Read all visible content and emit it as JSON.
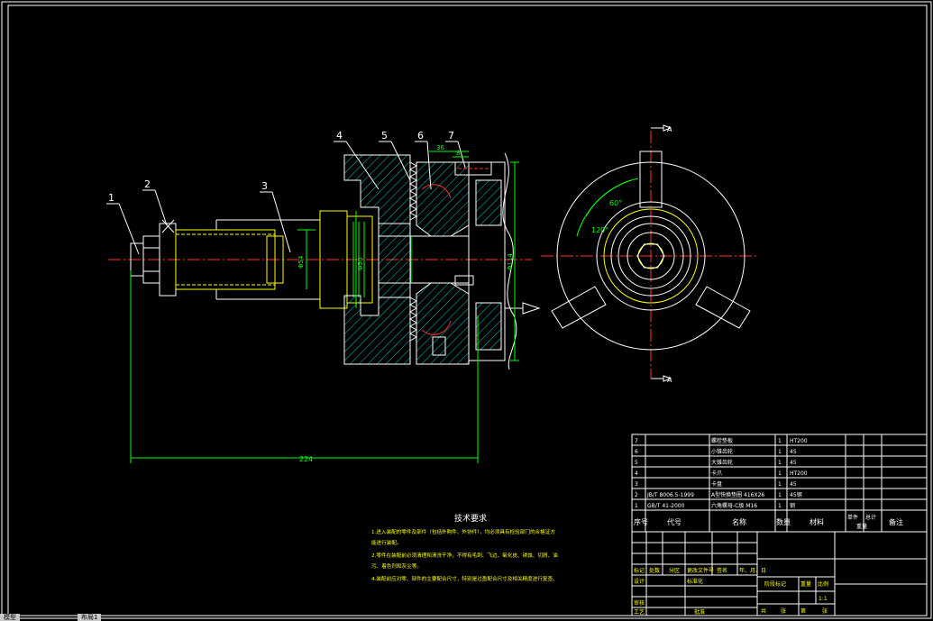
{
  "drawing": {
    "balloons": [
      "1",
      "2",
      "3",
      "4",
      "5",
      "6",
      "7"
    ],
    "dims": {
      "overall_length": "224",
      "d_top": "36",
      "d_small": "8",
      "dia_left": "Φ54",
      "dia_mid": "Φ50",
      "dia_right": "Φ114"
    },
    "angles": {
      "a1": "60°",
      "a2": "120°"
    },
    "section_mark": "A"
  },
  "bom": {
    "rows": [
      {
        "no": "7",
        "code": "",
        "name": "螺栓垫板",
        "qty": "1",
        "material": "HT200"
      },
      {
        "no": "6",
        "code": "",
        "name": "小锥齿轮",
        "qty": "1",
        "material": "45"
      },
      {
        "no": "5",
        "code": "",
        "name": "大锥齿轮",
        "qty": "1",
        "material": "45"
      },
      {
        "no": "4",
        "code": "",
        "name": "卡爪",
        "qty": "1",
        "material": "HT200"
      },
      {
        "no": "3",
        "code": "",
        "name": "卡盘",
        "qty": "1",
        "material": "45"
      },
      {
        "no": "2",
        "code": "JB/T 8006.5-1999",
        "name": "A型快换垫圈 416X26",
        "qty": "1",
        "material": "45钢"
      },
      {
        "no": "1",
        "code": "GB/T 41-2000",
        "name": "六角螺母-C级 M16",
        "qty": "1",
        "material": "钢"
      }
    ],
    "header": {
      "no": "序号",
      "code": "代号",
      "name": "名称",
      "qty": "数量",
      "material": "材料",
      "single": "单件",
      "total": "总计",
      "weight": "重量",
      "note": "备注"
    }
  },
  "tech": {
    "title": "技术要求",
    "lines": [
      "1.进入装配的零件及部件（包括外购件、外协件），均必须具有检验部门的合格证方",
      "能进行装配。",
      "2.零件在装配前必须清理和清洗干净，不得有毛刺、飞边、氧化皮、锈蚀、切屑、油",
      "污、着色剂和灰尘等。",
      "4.装配前应对零、部件的主要配合尺寸，特别是过盈配合尺寸及相关精度进行复查。"
    ]
  },
  "titleblock": {
    "marks": "标记",
    "count": "处数",
    "zone": "分区",
    "docno": "更改文件号",
    "sign": "签名",
    "date": "年、月、日",
    "design": "设计",
    "standard": "标准化",
    "stage_mark": "阶段标记",
    "weight": "重量",
    "scale": "比例",
    "scale_val": "1:1",
    "review": "审核",
    "process": "工艺",
    "approve": "批准",
    "total": "共",
    "sheets": "张",
    "page": "第",
    "sheet": "张"
  },
  "tabs": [
    "模型",
    "布局1"
  ]
}
